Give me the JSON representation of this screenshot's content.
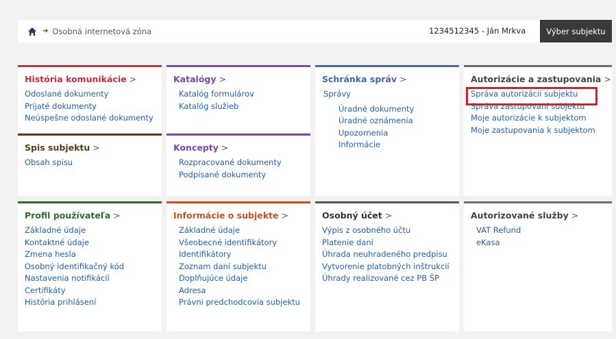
{
  "topbar": {
    "breadcrumb": "Osobná internetová zóna",
    "user": "1234512345 - Ján Mrkva",
    "subject_button": "Výber subjektu"
  },
  "colors": {
    "history": "#d32a3c",
    "catalogs": "#7a45b0",
    "mailbox": "#3f66b0",
    "authorizations": "#6b6b6b",
    "spis": "#5b3a1a",
    "concepts": "#7a45b0",
    "profile": "#2f6b2f",
    "subject_info": "#c0522a",
    "account": "#555555",
    "services": "#6b6b6b",
    "link": "#1f5fb0",
    "highlight": "#e01a22"
  },
  "cards": {
    "history": {
      "title": "História komunikácie",
      "items": [
        "Odoslané dokumenty",
        "Prijaté dokumenty",
        "Neúspešne odoslané dokumenty"
      ]
    },
    "spis": {
      "title": "Spis subjektu",
      "items": [
        "Obsah spisu"
      ]
    },
    "catalogs": {
      "title": "Katalógy",
      "items": [
        "Katalóg formulárov",
        "Katalóg služieb"
      ]
    },
    "concepts": {
      "title": "Koncepty",
      "items": [
        "Rozpracované dokumenty",
        "Podpísané dokumenty"
      ]
    },
    "mailbox": {
      "title": "Schránka správ",
      "subhead": "Správy",
      "items": [
        "Úradné dokumenty",
        "Úradné oznámenia",
        "Upozornenia",
        "Informácie"
      ]
    },
    "authorizations": {
      "title": "Autorizácie a zastupovania",
      "items": [
        "Správa autorizácií subjektu",
        "Správa zastupovaní subjektu",
        "Moje autorizácie k subjektom",
        "Moje zastupovania k subjektom"
      ]
    },
    "profile": {
      "title": "Profil používateľa",
      "items": [
        "Základné údaje",
        "Kontaktné údaje",
        "Zmena hesla",
        "Osobný identifikačný kód",
        "Nastavenia notifikácií",
        "Certifikáty",
        "História prihlásení"
      ]
    },
    "subject_info": {
      "title": "Informácie o subjekte",
      "items": [
        "Základné údaje",
        "Všeobecné identifikátory",
        "Identifikátory",
        "Zoznam daní subjektu",
        "Doplňujúce údaje",
        "Adresa",
        "Právni predchodcovia subjektu"
      ]
    },
    "account": {
      "title": "Osobný účet",
      "items": [
        "Výpis z osobného účtu",
        "Platenie daní",
        "Úhrada neuhradeného predpisu",
        "Vytvorenie platobných inštrukcií",
        "Úhrady realizované cez PB ŠP"
      ]
    },
    "services": {
      "title": "Autorizované služby",
      "items": [
        "VAT Refund",
        "eKasa"
      ]
    }
  }
}
